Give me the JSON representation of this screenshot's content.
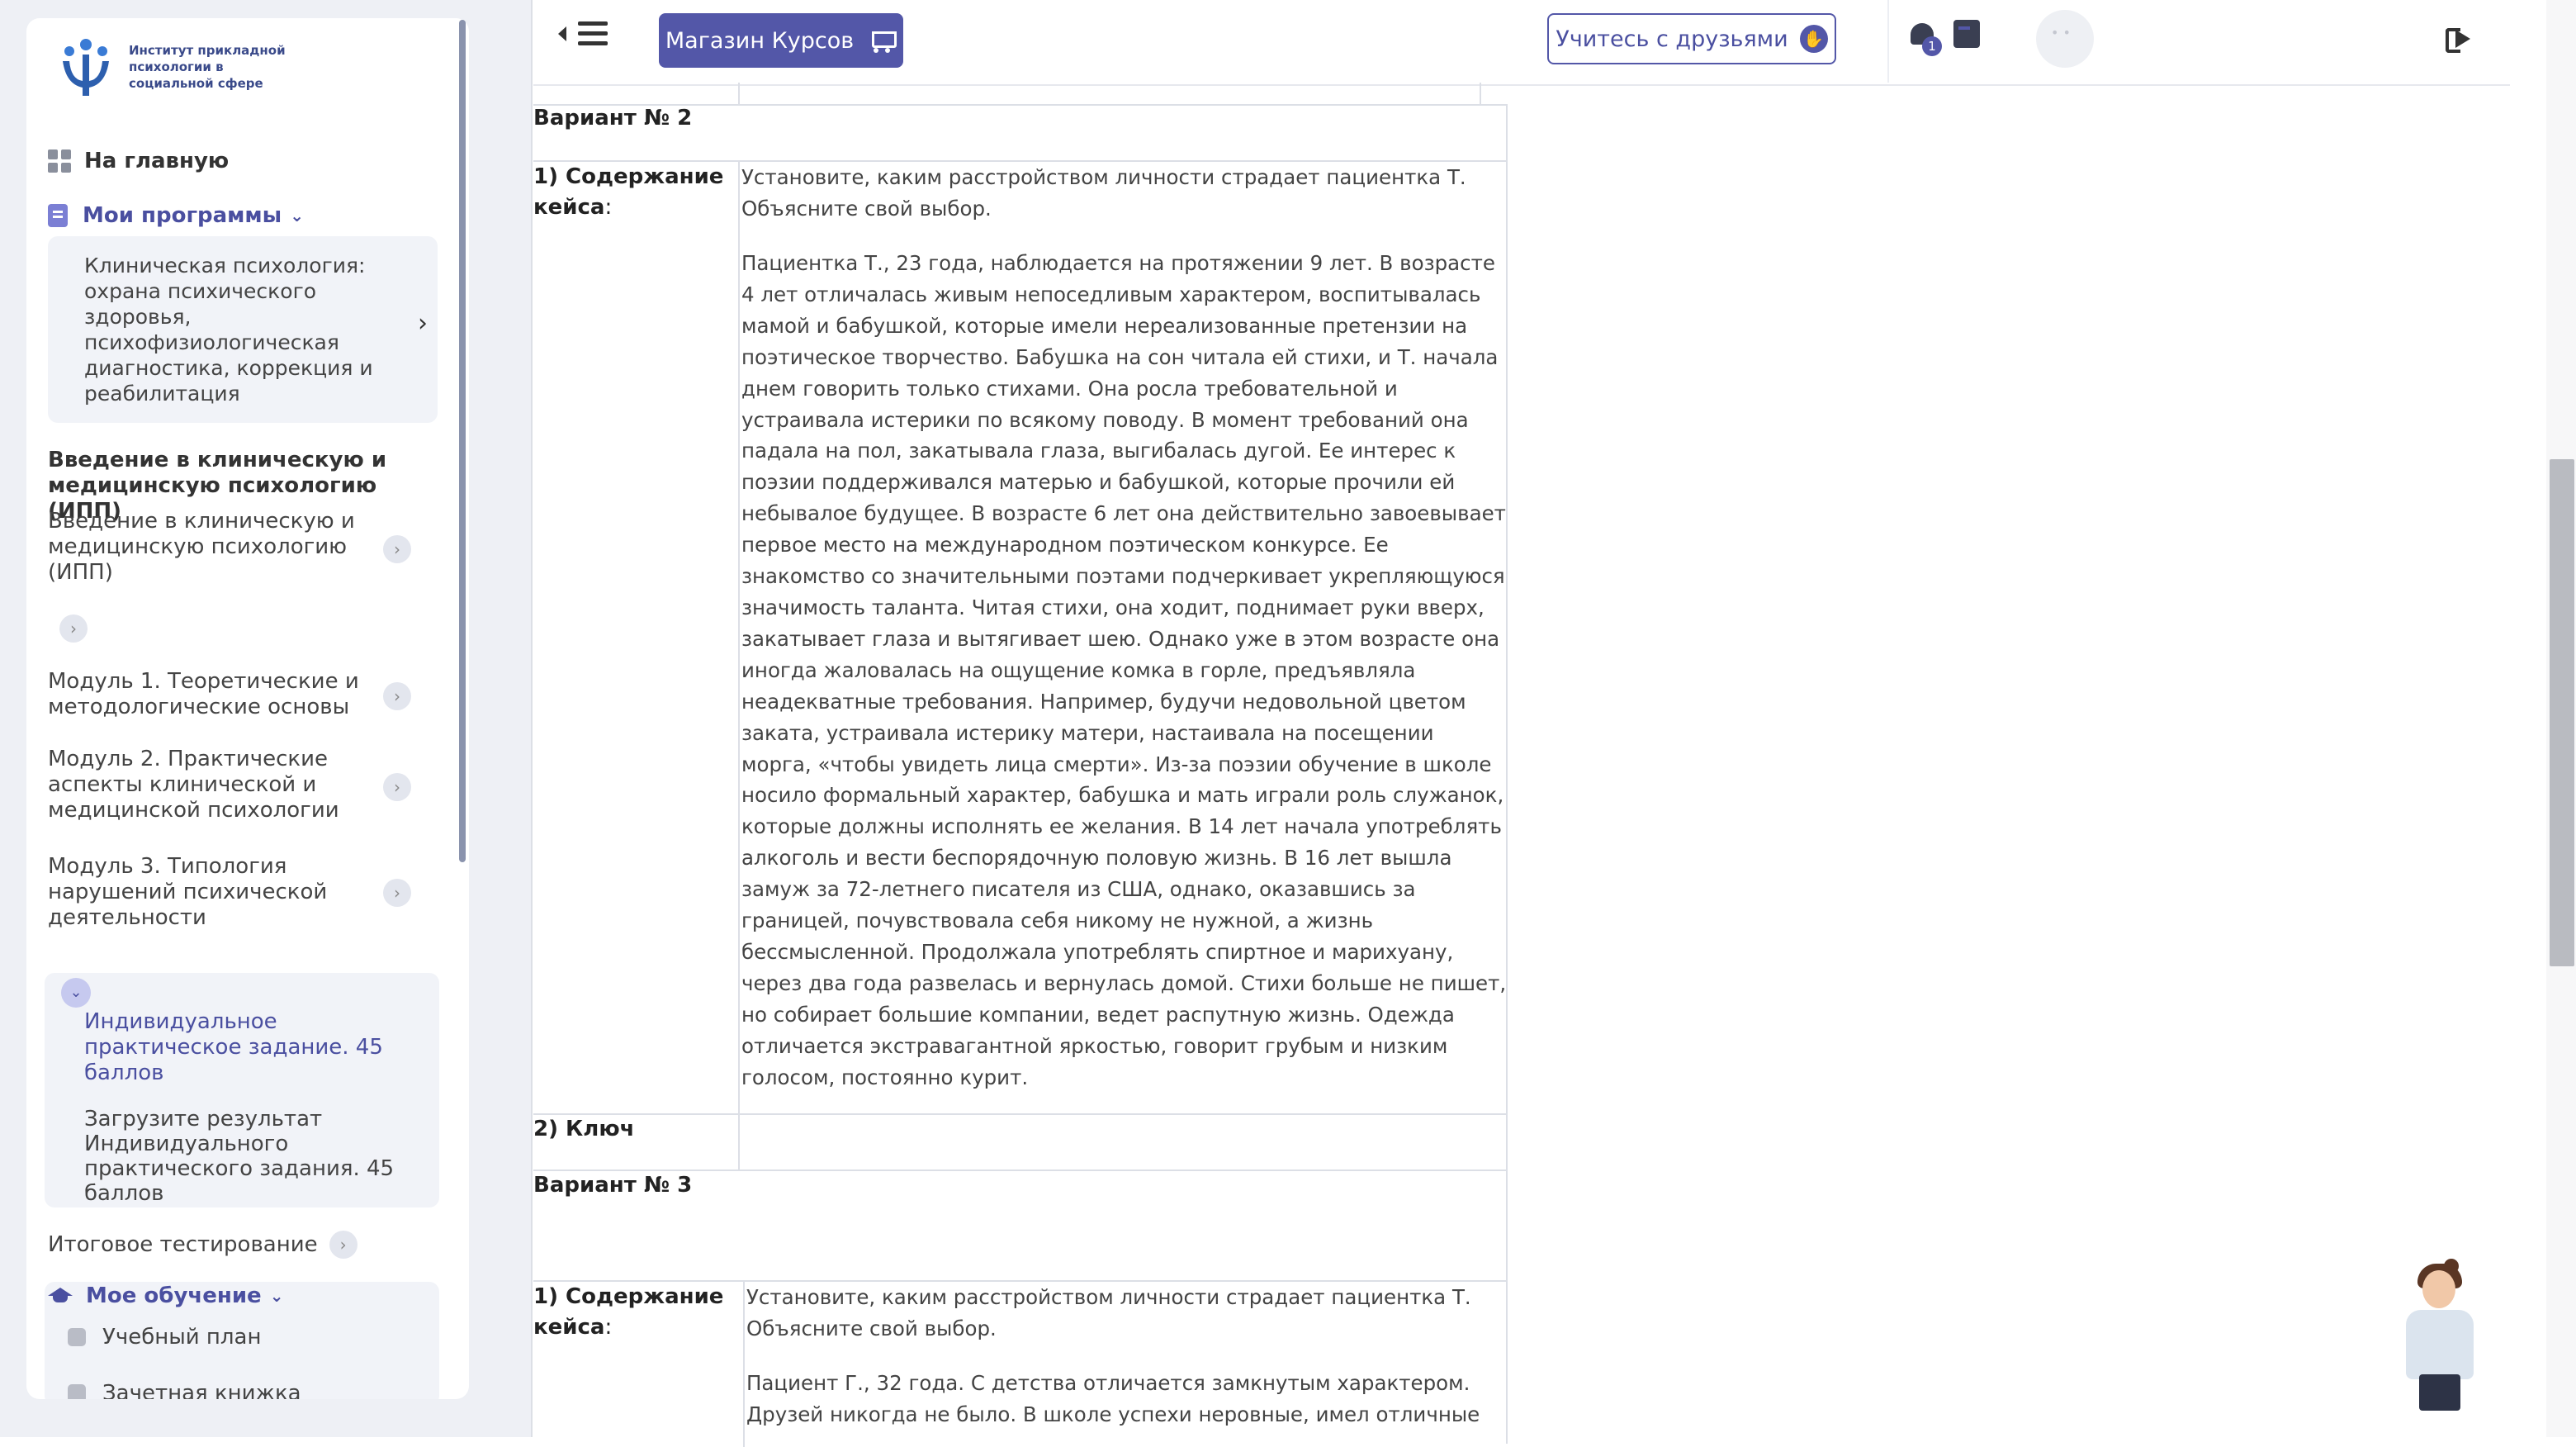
{
  "sidebar": {
    "logo_text": "Институт прикладной психологии в социальной сфере",
    "home": "На главную",
    "my_programs": "Мои программы",
    "program_name": "Клиническая психология: охрана психического здоровья, психофизиологическая диагностика, коррекция и реабилитация",
    "section_title": "Введение в клиническую и медицинскую психологию (ИПП)",
    "items": [
      {
        "label": "Введение в клиническую и медицинскую психологию (ИПП)"
      },
      {
        "label": ""
      },
      {
        "label": "Модуль 1. Теоретические и методологические основы"
      },
      {
        "label": "Модуль 2. Практические аспекты клинической и медицинской психологии"
      },
      {
        "label": "Модуль 3. Типология нарушений психической деятельности"
      }
    ],
    "active_module": "Индивидуальное практическое задание. 45 баллов",
    "active_sub": "Загрузите результат Индивидуального практического задания. 45 баллов",
    "final_test": "Итоговое тестирование",
    "my_learning": "Мое обучение",
    "learning_items": [
      {
        "label": "Учебный план",
        "icon": "book-icon"
      },
      {
        "label": "Зачетная книжка",
        "icon": "gradebook-icon"
      }
    ]
  },
  "header": {
    "shop_label": "Магазин Курсов",
    "friends_label": "Учитесь с друзьями",
    "notifications_count": "1"
  },
  "content": {
    "variant2_title": "Вариант № 2",
    "case_label_bold": "1) Содержание кейса",
    "case_label_colon": ":",
    "variant2_task": "Установите, каким расстройством личности страдает пациентка Т. Объясните свой выбор.",
    "variant2_text": "Пациентка Т., 23 года, наблюдается на протяжении 9 лет. В возрасте 4 лет отличалась живым непоседливым характером, воспитывалась мамой и бабушкой, которые имели нереализованные претензии на поэтическое творчество. Бабушка на сон читала ей стихи, и Т. начала днем говорить только стихами. Она росла требовательной и устраивала истерики по всякому поводу. В момент требований она падала на пол, закатывала глаза, выгибалась дугой. Ее интерес к поэзии поддерживался матерью и бабушкой, которые прочили ей небывалое будущее. В возрасте 6 лет она действительно завоевывает первое место на международном поэтическом конкурсе. Ее знакомство со значительными поэтами подчеркивает укрепляющуюся значимость таланта. Читая стихи, она ходит, поднимает руки вверх, закатывает глаза и вытягивает шею. Однако уже в этом возрасте она иногда жаловалась на ощущение комка в горле, предъявляла неадекватные требования. Например, будучи недовольной цветом заката, устраивала истерику матери, настаивала на посещении морга, «чтобы увидеть лица смерти». Из-за поэзии обучение в школе носило формальный характер, бабушка и мать играли роль служанок, которые должны исполнять ее желания. В 14 лет начала употреблять алкоголь и вести беспорядочную половую жизнь. В 16 лет вышла замуж за 72-летнего писателя из США, однако, оказавшись за границей, почувствовала себя никому не нужной, а жизнь бессмысленной. Продолжала употреблять спиртное и марихуану, через два года развелась и вернулась домой. Стихи больше не пишет, но собирает большие компании, ведет распутную жизнь. Одежда отличается экстравагантной яркостью, говорит грубым и низким голосом, постоянно курит.",
    "key_label": "2) Ключ",
    "variant3_title": "Вариант № 3",
    "variant3_task": "Установите, каким расстройством личности страдает пациентка Т. Объясните свой выбор.",
    "variant3_text": "Пациент Г., 32 года. С детства отличается замкнутым характером. Друзей никогда не было. В школе успехи неровные, имел отличные"
  }
}
